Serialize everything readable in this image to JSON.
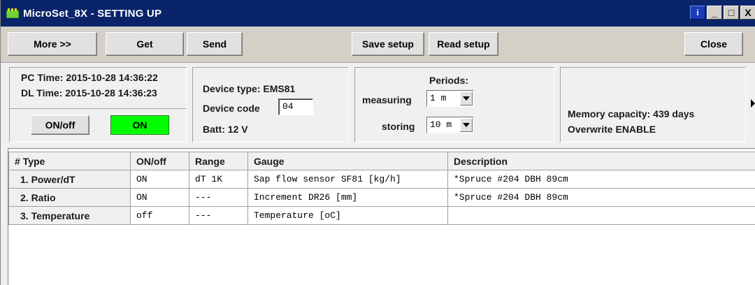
{
  "window": {
    "title": "MicroSet_8X - SETTING UP",
    "controls": {
      "info": "i",
      "minimize": "_",
      "maximize": "□",
      "close": "X"
    }
  },
  "toolbar": {
    "more_prefix": "More >>",
    "get_label": "Get",
    "send_label": "Send",
    "save_setup_label": "Save setup",
    "read_setup_label": "Read setup",
    "close_label": "Close"
  },
  "time_panel": {
    "pc_time": "PC Time: 2015-10-28 14:36:22",
    "dl_time": "DL Time: 2015-10-28 14:36:23",
    "onoff_button": "ON/off",
    "status": "ON",
    "status_color": "#00ff00"
  },
  "device_panel": {
    "device_type": "Device type: EMS81",
    "device_code_label": "Device code",
    "device_code_value": "04",
    "batt": "Batt: 12 V"
  },
  "periods_panel": {
    "title": "Periods:",
    "measuring_label": "measuring",
    "measuring_value": "1 m",
    "storing_label": "storing",
    "storing_value": "10 m"
  },
  "memory_panel": {
    "memory_capacity": "Memory capacity: 439 days",
    "overwrite": "Overwrite ENABLE"
  },
  "table": {
    "headers": [
      "# Type",
      "ON/off",
      "Range",
      "Gauge",
      "Description"
    ],
    "rows": [
      [
        "1. Power/dT",
        "ON",
        "dT 1K",
        "Sap flow sensor SF81 [kg/h]",
        "*Spruce #204 DBH 89cm"
      ],
      [
        "2. Ratio",
        "ON",
        "---",
        "Increment DR26 [mm]",
        "*Spruce #204 DBH 89cm"
      ],
      [
        "3. Temperature",
        "off",
        "---",
        "Temperature [oC]",
        ""
      ]
    ]
  }
}
